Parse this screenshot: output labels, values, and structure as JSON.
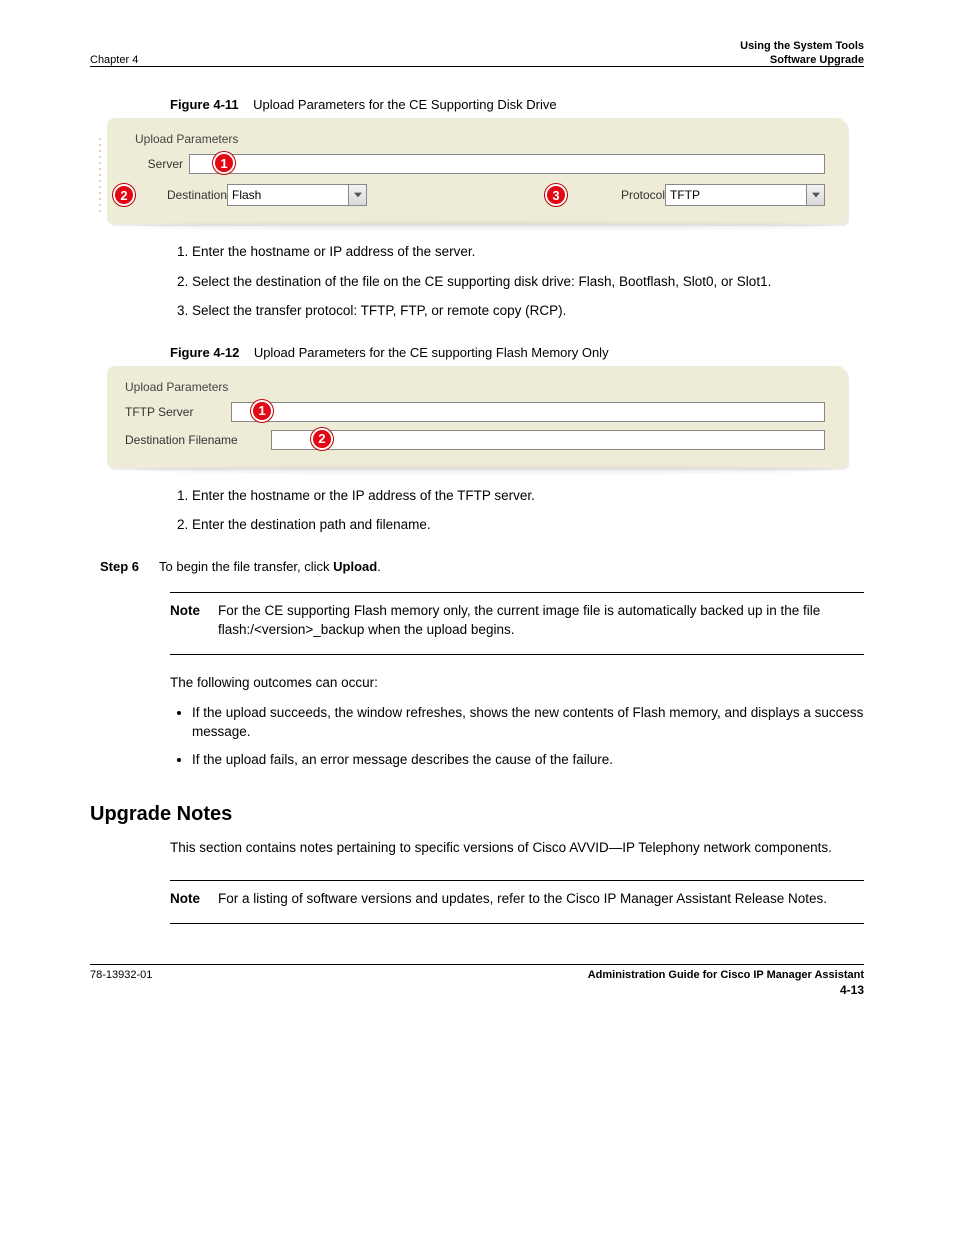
{
  "header": {
    "chapter": "Chapter 4",
    "title": "Using the System Tools",
    "section_right": "Software Upgrade"
  },
  "fig1": {
    "caption_num": "Figure 4-11",
    "caption_text": "Upload Parameters for the CE Supporting Disk Drive",
    "panel_title": "Upload Parameters",
    "server_label": "Server",
    "server_value": "",
    "destination_label": "Destination",
    "destination_value": "Flash",
    "protocol_label": "Protocol",
    "protocol_value": "TFTP",
    "badges": {
      "b1": "1",
      "b2": "2",
      "b3": "3"
    },
    "points": [
      "Enter the hostname or IP address of the server.",
      "Select the destination of the file on the CE supporting disk drive: Flash, Bootflash, Slot0, or Slot1.",
      "Select the transfer protocol: TFTP, FTP, or remote copy (RCP)."
    ]
  },
  "fig2": {
    "caption_num": "Figure 4-12",
    "caption_text": "Upload Parameters for the CE supporting Flash Memory Only",
    "panel_title": "Upload Parameters",
    "tftp_label": "TFTP Server",
    "tftp_value": "",
    "dest_label": "Destination Filename",
    "dest_value": "",
    "badges": {
      "b1": "1",
      "b2": "2"
    },
    "points": [
      "Enter the hostname or the IP address of the TFTP server.",
      "Enter the destination path and filename."
    ]
  },
  "step6": {
    "label": "Step 6",
    "text": "To begin the file transfer, click ",
    "button": "Upload",
    "tail": "."
  },
  "note1": {
    "tag": "Note",
    "text": "For the CE supporting Flash memory only, the current image file is automatically backed up in the file flash:/<version>_backup when the upload begins."
  },
  "outcome_intro": "The following outcomes can occur:",
  "outcomes": [
    "If the upload succeeds, the window refreshes, shows the new contents of Flash memory, and displays a success message.",
    "If the upload fails, an error message describes the cause of the failure."
  ],
  "notes_heading": "Upgrade Notes",
  "notes_text_1": "This section contains notes pertaining to specific versions of ",
  "notes_link": "Cisco AVVID—IP Telephony",
  "notes_text_2": " network components.",
  "note2": {
    "tag": "Note",
    "text": "For a listing of software versions and updates, refer to the Cisco IP Manager Assistant Release Notes."
  },
  "footer": {
    "doctitle": "Administration Guide for Cisco IP Manager Assistant",
    "docnum": "78-13932-01",
    "page": "4-13"
  }
}
